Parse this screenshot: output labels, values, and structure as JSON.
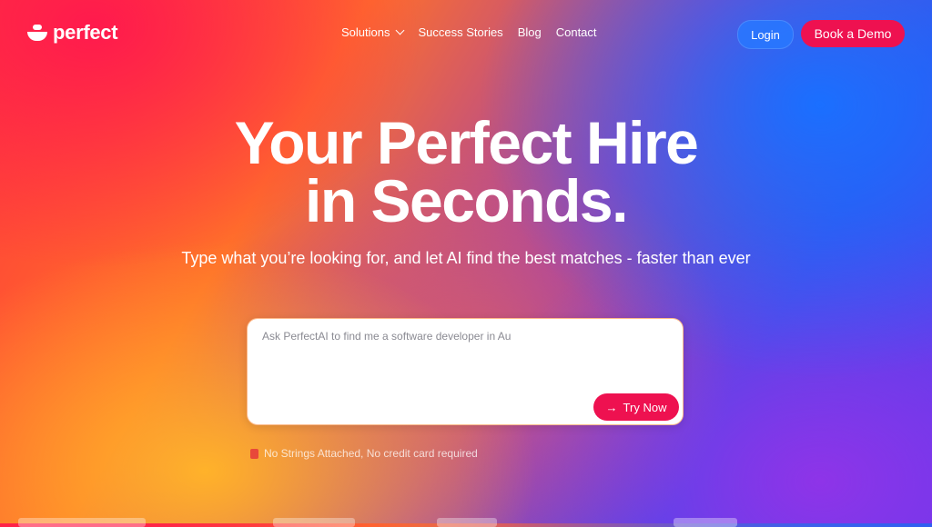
{
  "brand": {
    "name": "perfect"
  },
  "nav": {
    "items": [
      {
        "label": "Solutions",
        "has_dropdown": true
      },
      {
        "label": "Success Stories"
      },
      {
        "label": "Blog"
      },
      {
        "label": "Contact"
      }
    ],
    "login_label": "Login",
    "demo_label": "Book a Demo"
  },
  "hero": {
    "title_line1": "Your Perfect Hire",
    "title_line2": "in Seconds.",
    "subtitle": "Type what you’re looking for, and let AI find the best matches - faster than ever"
  },
  "prompt": {
    "value": "Ask PerfectAI to find me a software developer in Au",
    "button_label": "Try Now",
    "button_icon": "arrow-right-icon"
  },
  "note": {
    "text": "No Strings Attached, No credit card required",
    "icon": "flag-icon"
  },
  "colors": {
    "accent": "#ee1150",
    "login_bg": "#2878ff"
  }
}
